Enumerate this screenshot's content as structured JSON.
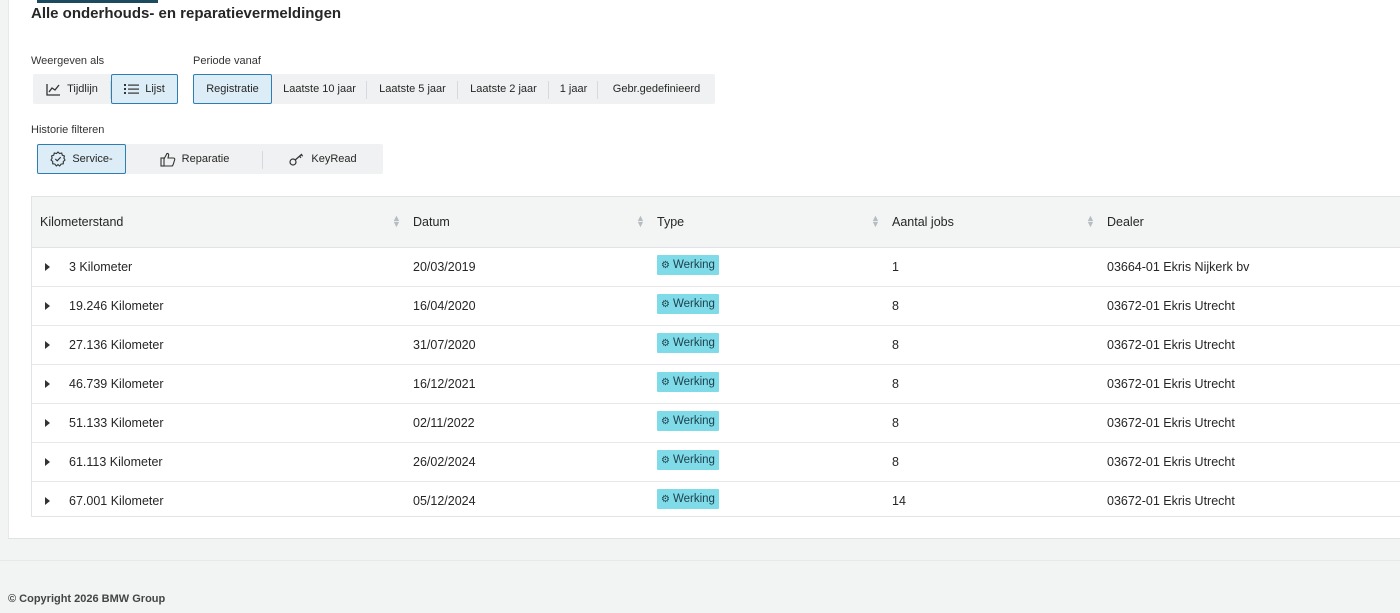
{
  "page": {
    "title": "Alle onderhouds- en reparatievermeldingen",
    "copyright": "© Copyright 2026 BMW Group"
  },
  "view": {
    "label": "Weergeven als",
    "options": [
      {
        "label": "Tijdlijn",
        "icon": "chart-line-icon",
        "active": false
      },
      {
        "label": "Lijst",
        "icon": "list-icon",
        "active": true
      }
    ]
  },
  "period": {
    "label": "Periode vanaf",
    "options": [
      {
        "label": "Registratie",
        "active": true
      },
      {
        "label": "Laatste 10 jaar",
        "active": false
      },
      {
        "label": "Laatste 5 jaar",
        "active": false
      },
      {
        "label": "Laatste 2 jaar",
        "active": false
      },
      {
        "label": "1 jaar",
        "active": false
      },
      {
        "label": "Gebr.gedefinieerd",
        "active": false
      }
    ]
  },
  "filter": {
    "label": "Historie filteren",
    "options": [
      {
        "label": "Service-",
        "icon": "service-gear-icon",
        "active": true
      },
      {
        "label": "Reparatie",
        "icon": "thumbs-up-icon",
        "active": false
      },
      {
        "label": "KeyRead",
        "icon": "key-icon",
        "active": false
      }
    ]
  },
  "table": {
    "columns": [
      "Kilometerstand",
      "Datum",
      "Type",
      "Aantal jobs",
      "Dealer"
    ],
    "rows": [
      {
        "km": "3 Kilometer",
        "date": "20/03/2019",
        "type": "Werking",
        "jobs": "1",
        "dealer": "03664-01 Ekris Nijkerk bv"
      },
      {
        "km": "19.246 Kilometer",
        "date": "16/04/2020",
        "type": "Werking",
        "jobs": "8",
        "dealer": "03672-01 Ekris Utrecht"
      },
      {
        "km": "27.136 Kilometer",
        "date": "31/07/2020",
        "type": "Werking",
        "jobs": "8",
        "dealer": "03672-01 Ekris Utrecht"
      },
      {
        "km": "46.739 Kilometer",
        "date": "16/12/2021",
        "type": "Werking",
        "jobs": "8",
        "dealer": "03672-01 Ekris Utrecht"
      },
      {
        "km": "51.133 Kilometer",
        "date": "02/11/2022",
        "type": "Werking",
        "jobs": "8",
        "dealer": "03672-01 Ekris Utrecht"
      },
      {
        "km": "61.113 Kilometer",
        "date": "26/02/2024",
        "type": "Werking",
        "jobs": "8",
        "dealer": "03672-01 Ekris Utrecht"
      },
      {
        "km": "67.001 Kilometer",
        "date": "05/12/2024",
        "type": "Werking",
        "jobs": "14",
        "dealer": "03672-01 Ekris Utrecht"
      }
    ]
  },
  "colors": {
    "accent": "#2f7eb3",
    "active_bg": "#dcedf7",
    "badge_bg": "#7fdbe8"
  }
}
